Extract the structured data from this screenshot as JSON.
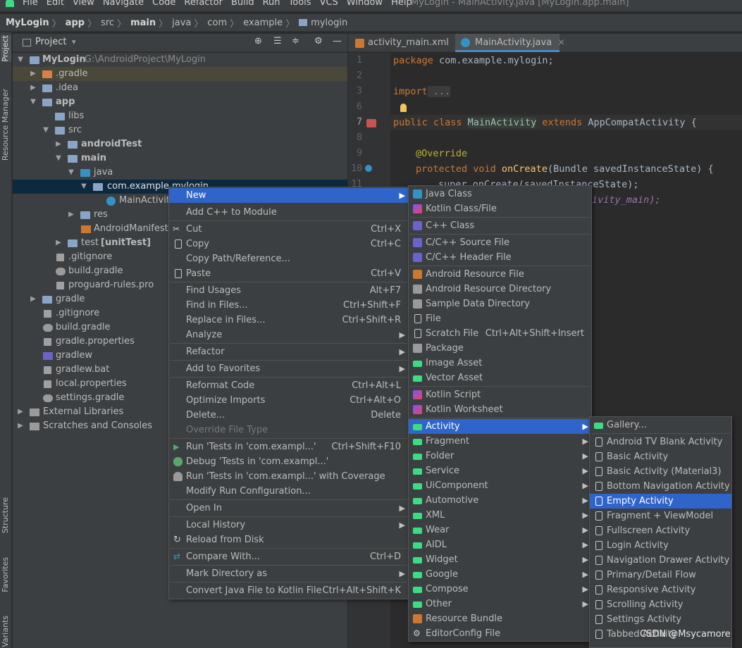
{
  "menubar": {
    "items": [
      "File",
      "Edit",
      "View",
      "Navigate",
      "Code",
      "Refactor",
      "Build",
      "Run",
      "Tools",
      "VCS",
      "Window",
      "Help"
    ],
    "window_title": "MyLogin - MainActivity.java [MyLogin.app.main]"
  },
  "breadcrumb": [
    "MyLogin",
    "app",
    "src",
    "main",
    "java",
    "com",
    "example",
    "mylogin"
  ],
  "left_strip": {
    "project": "Project",
    "resource_manager": "Resource Manager",
    "structure": "Structure",
    "favorites": "Favorites",
    "variants": "Variants"
  },
  "project_panel": {
    "title": "Project"
  },
  "tree": [
    {
      "label": "MyLogin",
      "extra": "G:\\AndroidProject\\MyLogin"
    },
    {
      "label": ".gradle"
    },
    {
      "label": ".idea"
    },
    {
      "label": "app"
    },
    {
      "label": "libs"
    },
    {
      "label": "src"
    },
    {
      "label": "androidTest"
    },
    {
      "label": "main"
    },
    {
      "label": "java"
    },
    {
      "label": "com.example.mylogin"
    },
    {
      "label": "MainActivity"
    },
    {
      "label": "res"
    },
    {
      "label": "AndroidManifest.x"
    },
    {
      "label": "test",
      "extra": "[unitTest]"
    },
    {
      "label": ".gitignore"
    },
    {
      "label": "build.gradle"
    },
    {
      "label": "proguard-rules.pro"
    },
    {
      "label": "gradle"
    },
    {
      "label": ".gitignore"
    },
    {
      "label": "build.gradle"
    },
    {
      "label": "gradle.properties"
    },
    {
      "label": "gradlew"
    },
    {
      "label": "gradlew.bat"
    },
    {
      "label": "local.properties"
    },
    {
      "label": "settings.gradle"
    },
    {
      "label": "External Libraries"
    },
    {
      "label": "Scratches and Consoles"
    }
  ],
  "editor_tabs": [
    {
      "label": "activity_main.xml"
    },
    {
      "label": "MainActivity.java"
    }
  ],
  "line_numbers": [
    "1",
    "2",
    "3",
    "6",
    "7",
    "8",
    "9",
    "10",
    "11"
  ],
  "code": {
    "l1_kw": "package",
    "l1_rest": " com.example.mylogin;",
    "l3_kw": "import",
    "l3_rest": " ...",
    "l7_kw": "public class ",
    "l7_cls": "MainActivity",
    "l7_kw2": " extends ",
    "l7_rest": "AppCompatActivity {",
    "l9": "@Override",
    "l10_kw": "protected void ",
    "l10_fn": "onCreate",
    "l10_rest": "(Bundle savedInstanceState) {",
    "l11": "super.onCreate(savedInstanceState);",
    "l12": "ivity_main);"
  },
  "context_menu": [
    {
      "label": "New",
      "sub": true
    },
    {
      "label": "Add C++ to Module"
    },
    {
      "label": "Cut",
      "shortcut": "Ctrl+X"
    },
    {
      "label": "Copy",
      "shortcut": "Ctrl+C"
    },
    {
      "label": "Copy Path/Reference..."
    },
    {
      "label": "Paste",
      "shortcut": "Ctrl+V"
    },
    {
      "label": "Find Usages",
      "shortcut": "Alt+F7"
    },
    {
      "label": "Find in Files...",
      "shortcut": "Ctrl+Shift+F"
    },
    {
      "label": "Replace in Files...",
      "shortcut": "Ctrl+Shift+R"
    },
    {
      "label": "Analyze",
      "sub": true
    },
    {
      "label": "Refactor",
      "sub": true
    },
    {
      "label": "Add to Favorites",
      "sub": true
    },
    {
      "label": "Reformat Code",
      "shortcut": "Ctrl+Alt+L"
    },
    {
      "label": "Optimize Imports",
      "shortcut": "Ctrl+Alt+O"
    },
    {
      "label": "Delete...",
      "shortcut": "Delete"
    },
    {
      "label": "Override File Type"
    },
    {
      "label": "Run 'Tests in 'com.exampl...'",
      "shortcut": "Ctrl+Shift+F10"
    },
    {
      "label": "Debug 'Tests in 'com.exampl...'"
    },
    {
      "label": "Run 'Tests in 'com.exampl...' with Coverage"
    },
    {
      "label": "Modify Run Configuration..."
    },
    {
      "label": "Open In",
      "sub": true
    },
    {
      "label": "Local History",
      "sub": true
    },
    {
      "label": "Reload from Disk"
    },
    {
      "label": "Compare With...",
      "shortcut": "Ctrl+D"
    },
    {
      "label": "Mark Directory as",
      "sub": true
    },
    {
      "label": "Convert Java File to Kotlin File",
      "shortcut": "Ctrl+Alt+Shift+K"
    }
  ],
  "new_menu": [
    {
      "label": "Java Class"
    },
    {
      "label": "Kotlin Class/File"
    },
    {
      "label": "C++ Class"
    },
    {
      "label": "C/C++ Source File"
    },
    {
      "label": "C/C++ Header File"
    },
    {
      "label": "Android Resource File"
    },
    {
      "label": "Android Resource Directory"
    },
    {
      "label": "Sample Data Directory"
    },
    {
      "label": "File"
    },
    {
      "label": "Scratch File",
      "shortcut": "Ctrl+Alt+Shift+Insert"
    },
    {
      "label": "Package"
    },
    {
      "label": "Image Asset"
    },
    {
      "label": "Vector Asset"
    },
    {
      "label": "Kotlin Script"
    },
    {
      "label": "Kotlin Worksheet"
    },
    {
      "label": "Activity",
      "sub": true
    },
    {
      "label": "Fragment",
      "sub": true
    },
    {
      "label": "Folder",
      "sub": true
    },
    {
      "label": "Service",
      "sub": true
    },
    {
      "label": "UiComponent",
      "sub": true
    },
    {
      "label": "Automotive",
      "sub": true
    },
    {
      "label": "XML",
      "sub": true
    },
    {
      "label": "Wear",
      "sub": true
    },
    {
      "label": "AIDL",
      "sub": true
    },
    {
      "label": "Widget",
      "sub": true
    },
    {
      "label": "Google",
      "sub": true
    },
    {
      "label": "Compose",
      "sub": true
    },
    {
      "label": "Other",
      "sub": true
    },
    {
      "label": "Resource Bundle"
    },
    {
      "label": "EditorConfig File"
    }
  ],
  "activity_menu": [
    {
      "label": "Gallery..."
    },
    {
      "label": "Android TV Blank Activity"
    },
    {
      "label": "Basic Activity"
    },
    {
      "label": "Basic Activity (Material3)"
    },
    {
      "label": "Bottom Navigation Activity"
    },
    {
      "label": "Empty Activity"
    },
    {
      "label": "Fragment + ViewModel"
    },
    {
      "label": "Fullscreen Activity"
    },
    {
      "label": "Login Activity"
    },
    {
      "label": "Navigation Drawer Activity"
    },
    {
      "label": "Primary/Detail Flow"
    },
    {
      "label": "Responsive Activity"
    },
    {
      "label": "Scrolling Activity"
    },
    {
      "label": "Settings Activity"
    },
    {
      "label": "Tabbed Activity"
    }
  ],
  "watermark": "CSDN @Msycamore"
}
